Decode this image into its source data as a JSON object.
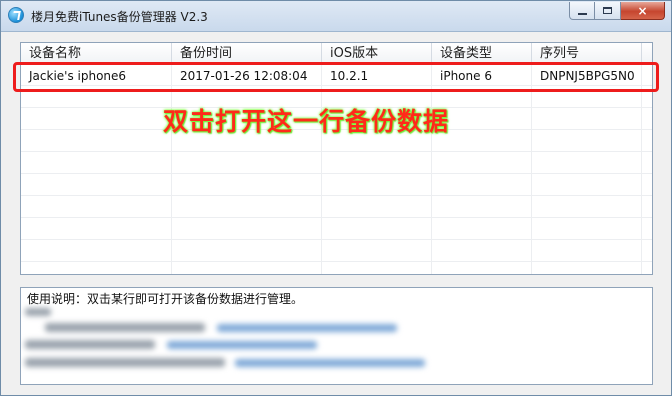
{
  "window": {
    "title": "楼月免费iTunes备份管理器 V2.3",
    "icon": "itunes-icon",
    "controls": {
      "minimize": "minimize-icon",
      "maximize": "maximize-icon",
      "close": "×"
    }
  },
  "table": {
    "columns": [
      "设备名称",
      "备份时间",
      "iOS版本",
      "设备类型",
      "序列号"
    ],
    "rows": [
      {
        "name": "Jackie's iphone6",
        "time": "2017-01-26 12:08:04",
        "ios": "10.2.1",
        "type": "iPhone 6",
        "serial": "DNPNJ5BPG5N0"
      }
    ]
  },
  "annotation": {
    "text": "双击打开这一行备份数据",
    "color": "#ff2a1a",
    "box_color": "#ee1c1c"
  },
  "info": {
    "line1": "使用说明：双击某行即可打开该备份数据进行管理。"
  },
  "colors": {
    "window_bg": "#f0f0f0",
    "title_gradient_top": "#dfe9f5",
    "close_button": "#c6462f"
  }
}
